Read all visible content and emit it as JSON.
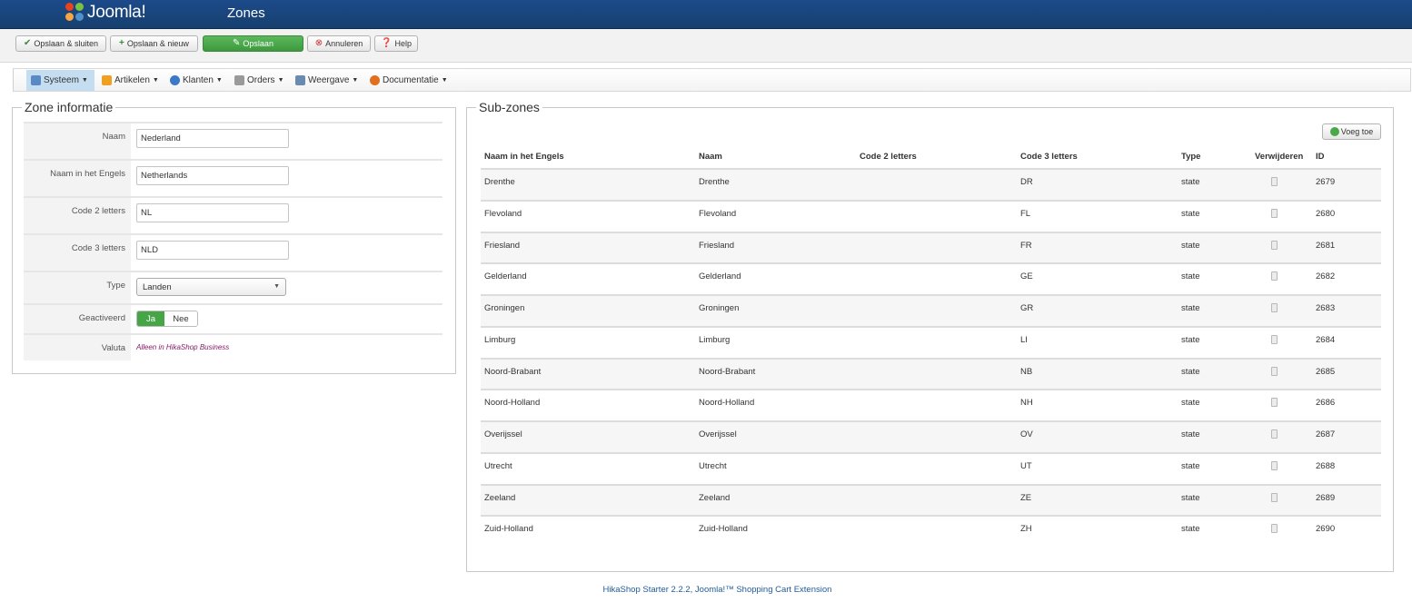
{
  "header": {
    "logo_text": "Joomla!",
    "title": "Zones"
  },
  "toolbar": {
    "save_close": "Opslaan & sluiten",
    "save_new": "Opslaan & nieuw",
    "save": "Opslaan",
    "cancel": "Annuleren",
    "help": "Help"
  },
  "menu": [
    {
      "label": "Systeem",
      "icon": "wrench-icon",
      "color": "#5a8ac6"
    },
    {
      "label": "Artikelen",
      "icon": "box-icon",
      "color": "#f0a020"
    },
    {
      "label": "Klanten",
      "icon": "users-icon",
      "color": "#3a78c8"
    },
    {
      "label": "Orders",
      "icon": "orders-icon",
      "color": "#9a9a9a"
    },
    {
      "label": "Weergave",
      "icon": "display-icon",
      "color": "#6a8ab0"
    },
    {
      "label": "Documentatie",
      "icon": "docs-icon",
      "color": "#e07020"
    }
  ],
  "zone_info": {
    "legend": "Zone informatie",
    "name_label": "Naam",
    "name_value": "Nederland",
    "english_label": "Naam in het Engels",
    "english_value": "Netherlands",
    "code2_label": "Code 2 letters",
    "code2_value": "NL",
    "code3_label": "Code 3 letters",
    "code3_value": "NLD",
    "type_label": "Type",
    "type_value": "Landen",
    "active_label": "Geactiveerd",
    "active_yes": "Ja",
    "active_no": "Nee",
    "currency_label": "Valuta",
    "currency_note": "Alleen in HikaShop Business"
  },
  "sub_zones": {
    "legend": "Sub-zones",
    "add_label": "Voeg toe",
    "columns": [
      "Naam in het Engels",
      "Naam",
      "Code 2 letters",
      "Code 3 letters",
      "Type",
      "Verwijderen",
      "ID"
    ],
    "rows": [
      [
        "Drenthe",
        "Drenthe",
        "",
        "DR",
        "state",
        "2679"
      ],
      [
        "Flevoland",
        "Flevoland",
        "",
        "FL",
        "state",
        "2680"
      ],
      [
        "Friesland",
        "Friesland",
        "",
        "FR",
        "state",
        "2681"
      ],
      [
        "Gelderland",
        "Gelderland",
        "",
        "GE",
        "state",
        "2682"
      ],
      [
        "Groningen",
        "Groningen",
        "",
        "GR",
        "state",
        "2683"
      ],
      [
        "Limburg",
        "Limburg",
        "",
        "LI",
        "state",
        "2684"
      ],
      [
        "Noord-Brabant",
        "Noord-Brabant",
        "",
        "NB",
        "state",
        "2685"
      ],
      [
        "Noord-Holland",
        "Noord-Holland",
        "",
        "NH",
        "state",
        "2686"
      ],
      [
        "Overijssel",
        "Overijssel",
        "",
        "OV",
        "state",
        "2687"
      ],
      [
        "Utrecht",
        "Utrecht",
        "",
        "UT",
        "state",
        "2688"
      ],
      [
        "Zeeland",
        "Zeeland",
        "",
        "ZE",
        "state",
        "2689"
      ],
      [
        "Zuid-Holland",
        "Zuid-Holland",
        "",
        "ZH",
        "state",
        "2690"
      ]
    ]
  },
  "footer": {
    "text": "HikaShop Starter 2.2.2, Joomla!™ Shopping Cart Extension"
  }
}
